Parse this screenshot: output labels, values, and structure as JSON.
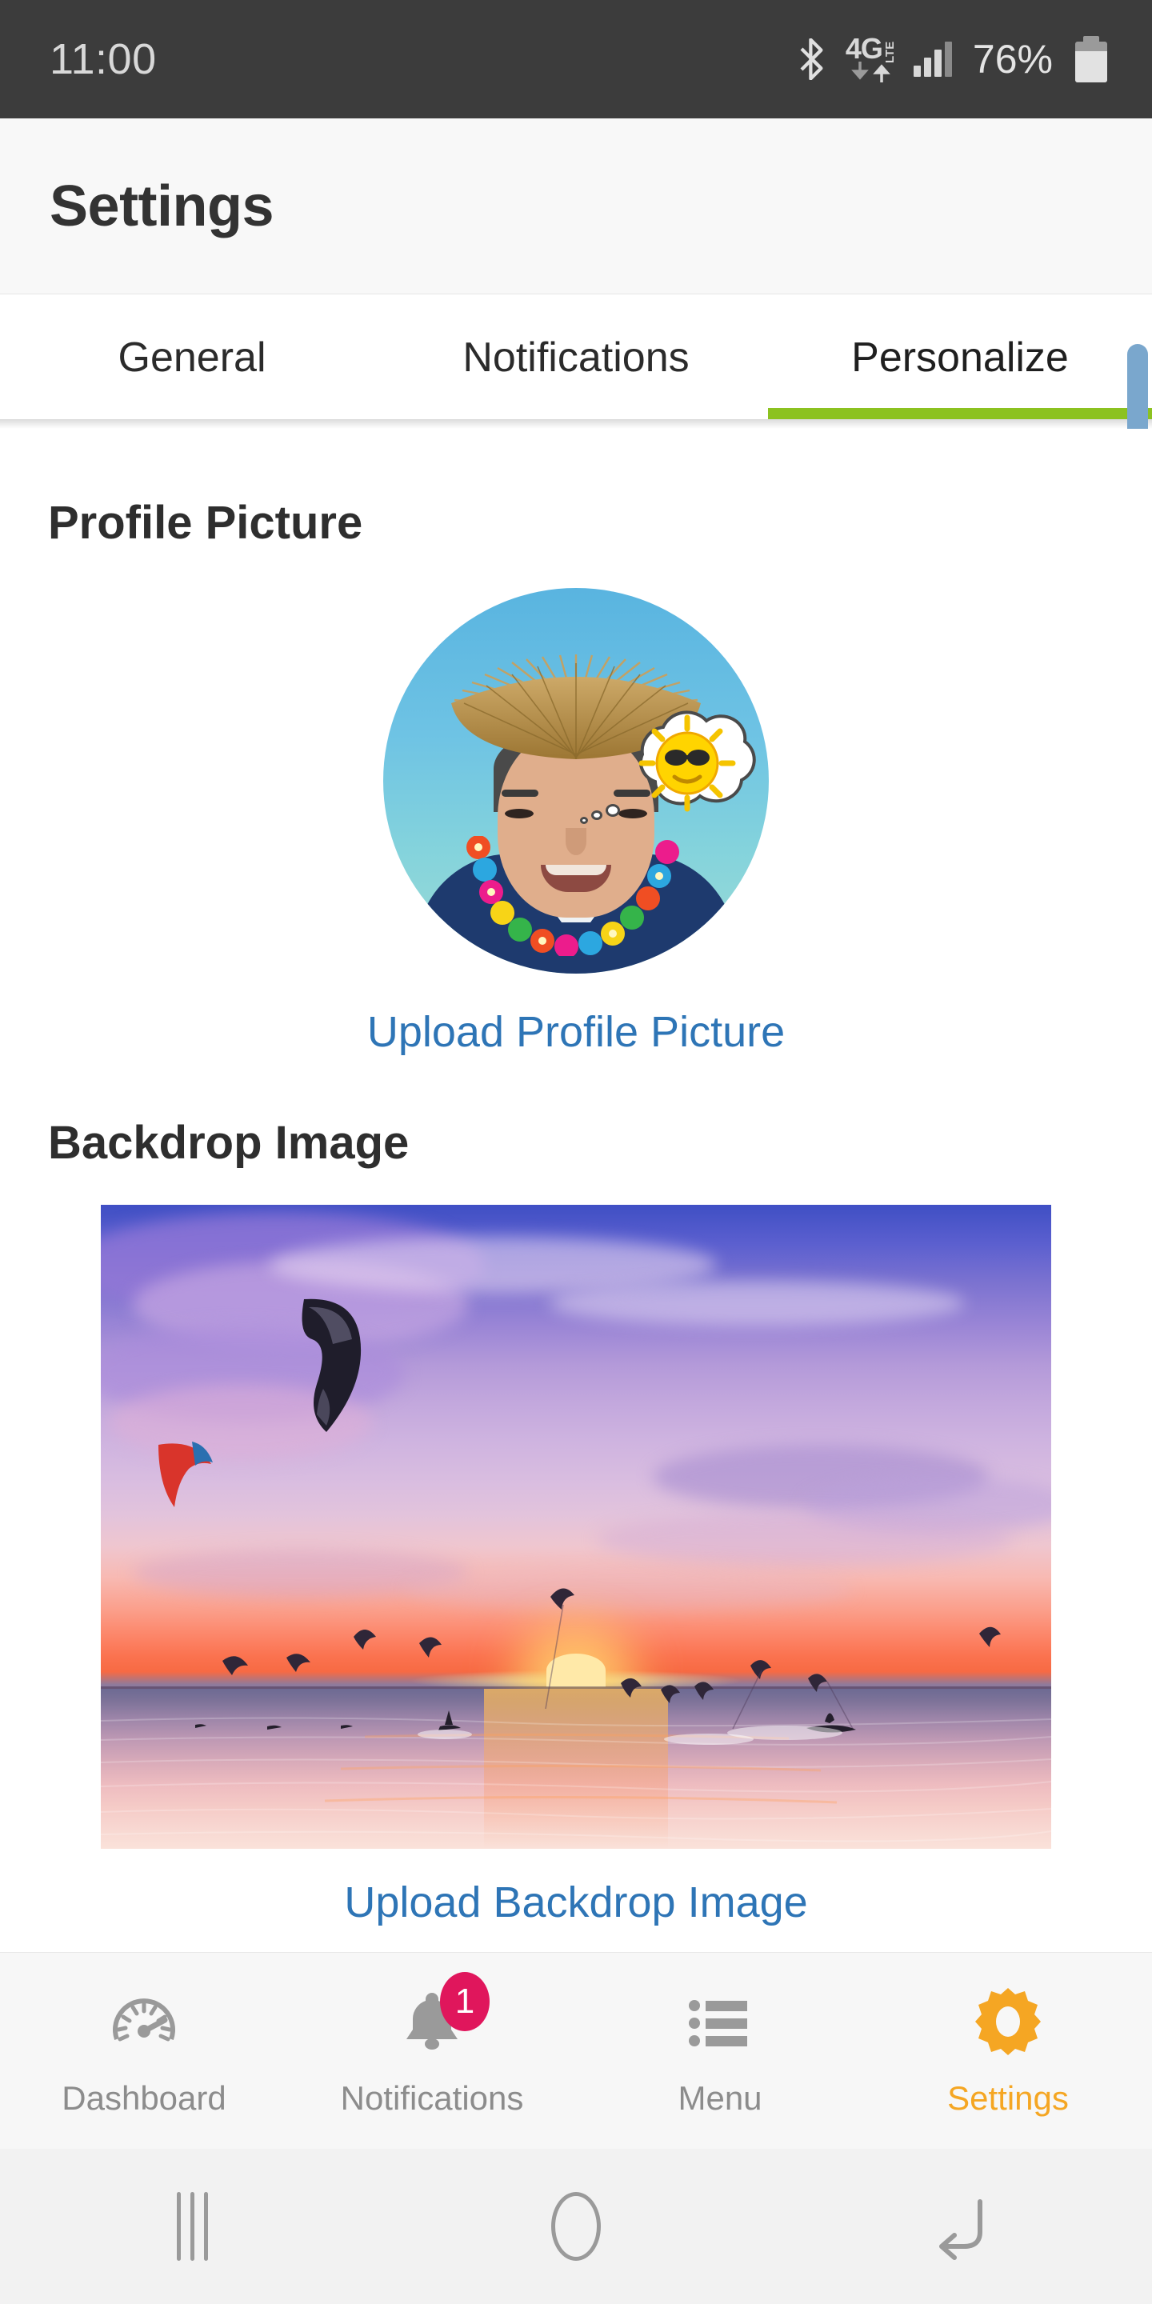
{
  "status_bar": {
    "clock": "11:00",
    "battery_percent": "76%",
    "icons": [
      "bluetooth-icon",
      "4g-lte-icon",
      "signal-bars-icon",
      "battery-icon"
    ],
    "network_label": "4G",
    "network_sub": "LTE",
    "background": "#3c3c3c",
    "foreground": "#d8d8d8"
  },
  "header": {
    "title": "Settings",
    "background": "#f8f8f8"
  },
  "tabs": {
    "active_color": "#8cc220",
    "items": [
      {
        "label": "General",
        "active": false
      },
      {
        "label": "Notifications",
        "active": false
      },
      {
        "label": "Personalize",
        "active": true
      }
    ]
  },
  "scrollbar": {
    "color": "#7aa7cd"
  },
  "main": {
    "link_color": "#2e75b6",
    "profile_section": {
      "title": "Profile Picture",
      "upload_label": "Upload Profile Picture",
      "avatar": {
        "name": "user-avatar",
        "description": "Smiling man wearing a fringed straw sun hat and a colorful Hawaiian flower lei over a navy sweater, against a blue sky-and-sea gradient, with a thought bubble containing a smiling sun wearing sunglasses",
        "background_top": "#59b4e0",
        "background_bottom": "#9ddcd4",
        "hat_color": "#b8914f",
        "shirt_color": "#1e3a6e"
      }
    },
    "backdrop_section": {
      "title": "Backdrop Image",
      "upload_label": "Upload Backdrop Image",
      "image": {
        "name": "backdrop-photo",
        "description": "Kitesurfing beach at sunset — purple, pink and orange sky over calm water with many kites and silhouetted riders",
        "sky_top": "#3f4fc4",
        "sunset_glow": "#fb7350",
        "sea_color": "#bf99b4"
      }
    }
  },
  "bottom_nav": {
    "active_color": "#f5a623",
    "inactive_color": "#8c8c8c",
    "badge_color": "#e0165c",
    "items": [
      {
        "label": "Dashboard",
        "icon": "speedometer-icon",
        "active": false,
        "badge": ""
      },
      {
        "label": "Notifications",
        "icon": "bell-icon",
        "active": false,
        "badge": "1"
      },
      {
        "label": "Menu",
        "icon": "list-icon",
        "active": false,
        "badge": ""
      },
      {
        "label": "Settings",
        "icon": "gear-icon",
        "active": true,
        "badge": ""
      }
    ]
  },
  "system_nav": {
    "buttons": [
      {
        "name": "recents-button",
        "icon": "recents-icon"
      },
      {
        "name": "home-button",
        "icon": "home-circle-icon"
      },
      {
        "name": "back-button",
        "icon": "back-arrow-icon"
      }
    ]
  }
}
